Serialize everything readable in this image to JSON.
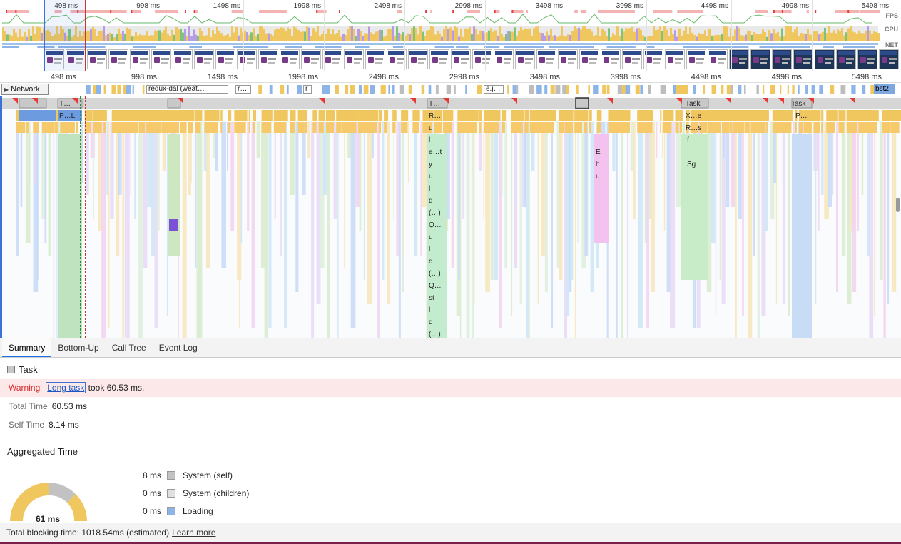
{
  "ruler": {
    "overview_ticks": [
      "498 ms",
      "998 ms",
      "1498 ms",
      "1998 ms",
      "2498 ms",
      "2998 ms",
      "3498 ms",
      "3998 ms",
      "4498 ms",
      "4998 ms",
      "5498 ms"
    ],
    "flame_ticks": [
      "498 ms",
      "998 ms",
      "1498 ms",
      "1998 ms",
      "2498 ms",
      "2998 ms",
      "3498 ms",
      "3998 ms",
      "4498 ms",
      "4998 ms",
      "5498 ms"
    ]
  },
  "overview": {
    "fps_label": "FPS",
    "cpu_label": "CPU",
    "net_label": "NET"
  },
  "network": {
    "toggle_label": "Network",
    "requests": [
      "redux-dal (weat…",
      "r…",
      "r",
      "e.j…"
    ],
    "last_request": "bst2"
  },
  "flame": {
    "labels": [
      "T…",
      "P…L",
      "T…",
      "R…",
      "u",
      "l",
      "e…t",
      "y",
      "u",
      "l",
      "d",
      "(…)",
      "Q…",
      "u",
      "l",
      "d",
      "(…)",
      "Q…",
      "st",
      "l",
      "d",
      "(…)",
      "E",
      "h",
      "u",
      "Task",
      "X…e",
      "R…s",
      "f",
      "Sg",
      "Task",
      "P…"
    ]
  },
  "details": {
    "tabs": [
      "Summary",
      "Bottom-Up",
      "Call Tree",
      "Event Log"
    ],
    "title": "Task",
    "warning_label": "Warning",
    "warning_link": "Long task",
    "warning_text": "took 60.53 ms.",
    "total_time_label": "Total Time",
    "total_time_value": "60.53 ms",
    "self_time_label": "Self Time",
    "self_time_value": "8.14 ms",
    "aggregated_title": "Aggregated Time",
    "donut_center": "61 ms",
    "legend": [
      {
        "value": "8 ms",
        "label": "System (self)",
        "color": "#c2c2c2"
      },
      {
        "value": "0 ms",
        "label": "System (children)",
        "color": "#e0e0e0"
      },
      {
        "value": "0 ms",
        "label": "Loading",
        "color": "#8cb4e8"
      }
    ]
  },
  "footer": {
    "text": "Total blocking time: 1018.54ms (estimated)",
    "link": "Learn more"
  },
  "colors": {
    "scripting": "#f0c75e",
    "rendering": "#b79ae8",
    "painting": "#7bc47b",
    "system": "#c8c8c8",
    "loading": "#8cb4e8",
    "long_task": "#e53935",
    "selection": "#3a72d6"
  }
}
